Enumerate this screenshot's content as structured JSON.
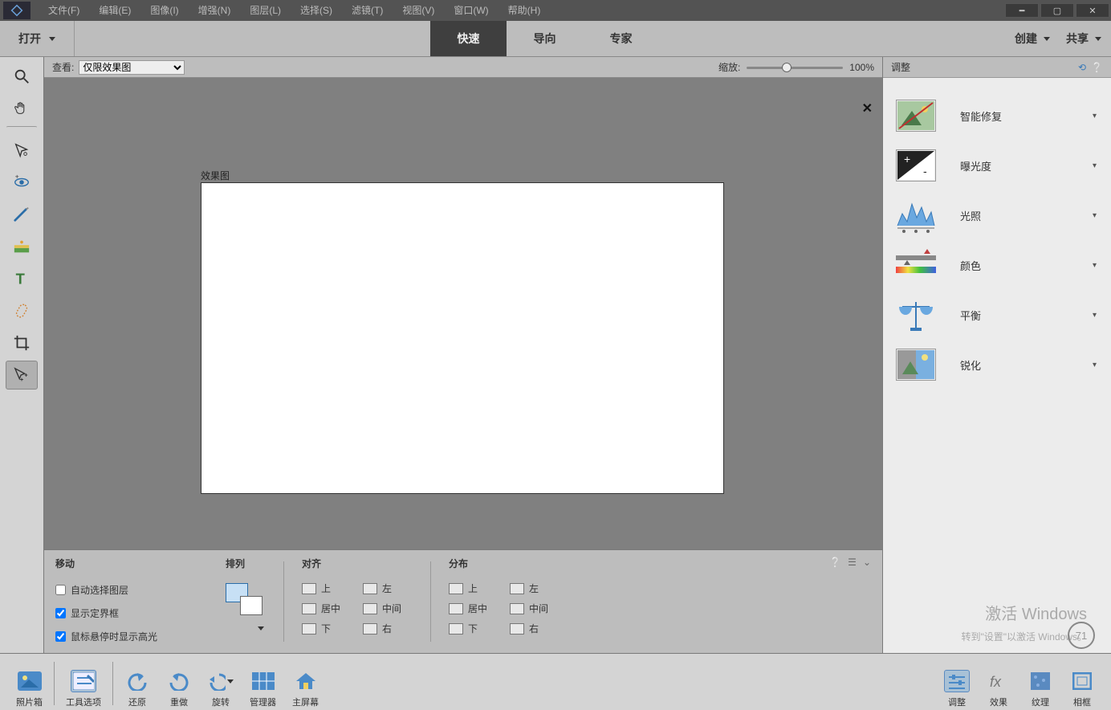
{
  "menu": {
    "file": "文件(F)",
    "edit": "编辑(E)",
    "image": "图像(I)",
    "enhance": "增强(N)",
    "layer": "图层(L)",
    "select": "选择(S)",
    "filter": "滤镜(T)",
    "view": "视图(V)",
    "window": "窗口(W)",
    "help": "帮助(H)"
  },
  "topbar": {
    "open": "打开",
    "modes": {
      "quick": "快速",
      "guided": "导向",
      "expert": "专家"
    },
    "create": "创建",
    "share": "共享"
  },
  "viewbar": {
    "viewLabel": "查看:",
    "viewOption": "仅限效果图",
    "zoomLabel": "缩放:",
    "zoomVal": "100%"
  },
  "canvas": {
    "label": "效果图"
  },
  "options": {
    "moveTitle": "移动",
    "autoSelect": "自动选择图层",
    "showBounds": "显示定界框",
    "hoverHighlight": "鼠标悬停时显示高光",
    "arrangeTitle": "排列",
    "alignTitle": "对齐",
    "distTitle": "分布",
    "top": "上",
    "vcenter": "居中",
    "bottom": "下",
    "left": "左",
    "hcenter": "中间",
    "right": "右"
  },
  "rpanel": {
    "title": "调整",
    "items": {
      "smartfix": "智能修复",
      "exposure": "曝光度",
      "lighting": "光照",
      "color": "颜色",
      "balance": "平衡",
      "sharpen": "锐化"
    }
  },
  "statusbar": {
    "photobin": "照片箱",
    "tooloptions": "工具选项",
    "undo": "还原",
    "redo": "重做",
    "rotate": "旋转",
    "organizer": "管理器",
    "home": "主屏幕",
    "adjust": "调整",
    "effects": "效果",
    "textures": "纹理",
    "frames": "相框"
  },
  "watermark": {
    "line1": "激活 Windows",
    "line2": "转到\"设置\"以激活 Windows。"
  },
  "badge": "71"
}
